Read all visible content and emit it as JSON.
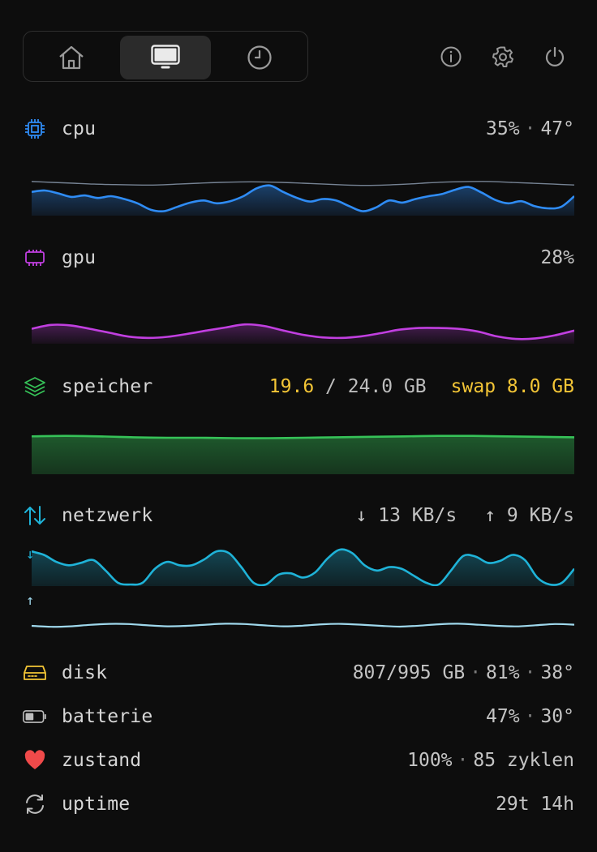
{
  "nav": {
    "tabs": [
      {
        "name": "home",
        "icon": "house-icon",
        "active": false
      },
      {
        "name": "monitor",
        "icon": "monitor-icon",
        "active": true
      },
      {
        "name": "history",
        "icon": "clock-icon",
        "active": false
      }
    ],
    "actions": [
      {
        "name": "info",
        "icon": "info-icon"
      },
      {
        "name": "settings",
        "icon": "gear-icon"
      },
      {
        "name": "power",
        "icon": "power-icon"
      }
    ]
  },
  "cpu": {
    "label": "cpu",
    "usage": "35%",
    "temp": "47°",
    "color": "#2f8cf5",
    "series": [
      0.62,
      0.66,
      0.58,
      0.48,
      0.52,
      0.45,
      0.5,
      0.42,
      0.3,
      0.12,
      0.08,
      0.2,
      0.32,
      0.38,
      0.3,
      0.36,
      0.5,
      0.72,
      0.8,
      0.62,
      0.46,
      0.35,
      0.42,
      0.38,
      0.22,
      0.08,
      0.18,
      0.38,
      0.32,
      0.42,
      0.5,
      0.56,
      0.68,
      0.76,
      0.6,
      0.4,
      0.3,
      0.36,
      0.22,
      0.16,
      0.2,
      0.5
    ],
    "temp_series": [
      0.78,
      0.76,
      0.74,
      0.72,
      0.71,
      0.7,
      0.7,
      0.72,
      0.74,
      0.76,
      0.77,
      0.77,
      0.76,
      0.74,
      0.72,
      0.7,
      0.69,
      0.7,
      0.72,
      0.75,
      0.77,
      0.78,
      0.78,
      0.76,
      0.74,
      0.72,
      0.7
    ]
  },
  "gpu": {
    "label": "gpu",
    "usage": "28%",
    "color": "#c13fe0",
    "series": [
      0.45,
      0.6,
      0.58,
      0.45,
      0.3,
      0.15,
      0.1,
      0.14,
      0.25,
      0.38,
      0.5,
      0.62,
      0.56,
      0.38,
      0.22,
      0.12,
      0.1,
      0.16,
      0.28,
      0.42,
      0.48,
      0.48,
      0.45,
      0.35,
      0.16,
      0.06,
      0.08,
      0.2,
      0.38
    ]
  },
  "memory": {
    "label": "speicher",
    "used": "19.6",
    "sep": " / ",
    "total": "24.0 GB",
    "swap_label": "swap",
    "swap_value": "8.0 GB",
    "color": "#36c258",
    "series": [
      0.82,
      0.83,
      0.82,
      0.8,
      0.79,
      0.79,
      0.78,
      0.78,
      0.79,
      0.8,
      0.81,
      0.82,
      0.83,
      0.83,
      0.82,
      0.81,
      0.8
    ]
  },
  "network": {
    "label": "netzwerk",
    "down_arrow": "↓",
    "down": "13 KB/s",
    "up_arrow": "↑",
    "up": "9 KB/s",
    "color_down": "#1fb3d8",
    "color_up": "#9fd8ec",
    "down_series": [
      0.95,
      0.85,
      0.65,
      0.55,
      0.62,
      0.7,
      0.4,
      0.05,
      0.0,
      0.05,
      0.45,
      0.65,
      0.55,
      0.55,
      0.72,
      0.95,
      0.9,
      0.5,
      0.05,
      0.0,
      0.28,
      0.32,
      0.2,
      0.35,
      0.75,
      1.0,
      0.9,
      0.55,
      0.4,
      0.5,
      0.45,
      0.25,
      0.05,
      0.0,
      0.4,
      0.82,
      0.8,
      0.62,
      0.68,
      0.85,
      0.7,
      0.2,
      0.0,
      0.05,
      0.45
    ],
    "up_series": [
      0.5,
      0.4,
      0.45,
      0.6,
      0.7,
      0.68,
      0.55,
      0.45,
      0.5,
      0.62,
      0.72,
      0.68,
      0.55,
      0.45,
      0.52,
      0.66,
      0.7,
      0.62,
      0.5,
      0.42,
      0.52,
      0.66,
      0.72,
      0.62,
      0.5,
      0.44,
      0.56,
      0.68,
      0.62
    ]
  },
  "disk": {
    "label": "disk",
    "used": "807/995 GB",
    "percent": "81%",
    "temp": "38°",
    "color": "#f3c536"
  },
  "battery": {
    "label": "batterie",
    "percent": "47%",
    "temp": "30°"
  },
  "health": {
    "label": "zustand",
    "percent": "100%",
    "cycles": "85 zyklen",
    "color": "#f04a4a"
  },
  "uptime": {
    "label": "uptime",
    "value": "29t 14h"
  }
}
